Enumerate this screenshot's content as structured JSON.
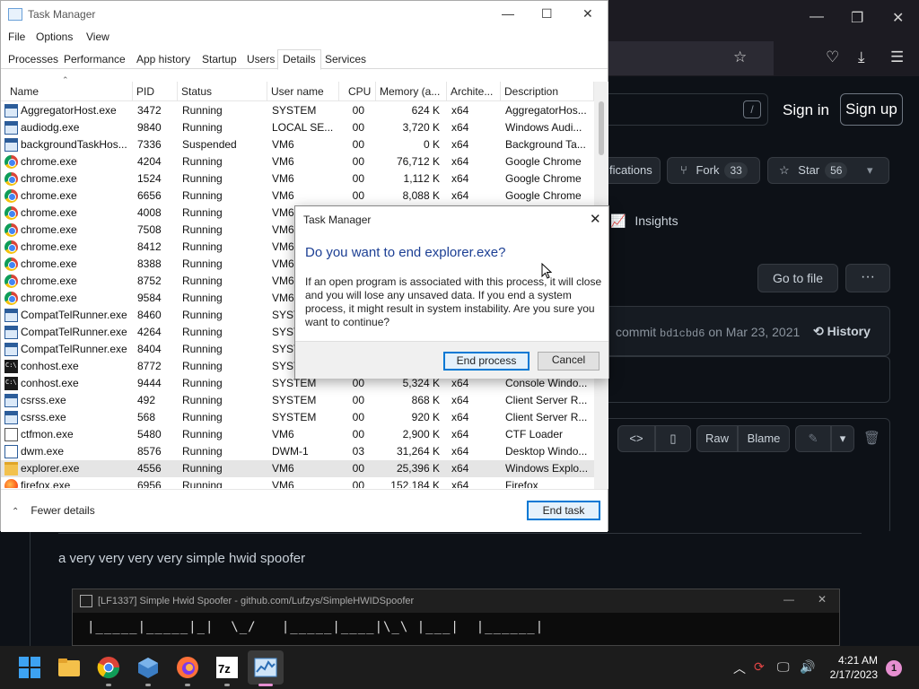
{
  "browser": {
    "controls": [
      "—",
      "❐",
      "✕"
    ],
    "toolbar_icons": [
      "star-icon",
      "pocket-icon",
      "download-icon",
      "menu-icon"
    ]
  },
  "github": {
    "slash": "/",
    "sign_in": "Sign in",
    "sign_up": "Sign up",
    "notifications_label": "fications",
    "fork_label": "Fork",
    "fork_count": "33",
    "star_label": "Star",
    "star_count": "56",
    "insights": "Insights",
    "go_to_file": "Go to file",
    "more": "···",
    "commit_text": "commit",
    "commit_sha": "bd1cbd6",
    "commit_date": "on Mar 23, 2021",
    "history": "History",
    "raw": "Raw",
    "blame": "Blame",
    "readme_text": "a very very very very simple hwid spoofer",
    "console_title": "[LF1337] Simple Hwid Spoofer - github.com/Lufzys/SimpleHWIDSpoofer",
    "console_art": "|_____|_____|_|  \\_/   |_____|____|\\_\\ |___|  |______|"
  },
  "task_manager": {
    "title": "Task Manager",
    "menu": [
      "File",
      "Options",
      "View"
    ],
    "tabs": [
      "Processes",
      "Performance",
      "App history",
      "Startup",
      "Users",
      "Details",
      "Services"
    ],
    "active_tab": "Details",
    "columns": [
      "Name",
      "PID",
      "Status",
      "User name",
      "CPU",
      "Memory (a...",
      "Archite...",
      "Description"
    ],
    "rows": [
      {
        "icon": "app",
        "name": "AggregatorHost.exe",
        "pid": "3472",
        "status": "Running",
        "user": "SYSTEM",
        "cpu": "00",
        "mem": "624 K",
        "arch": "x64",
        "desc": "AggregatorHos..."
      },
      {
        "icon": "app",
        "name": "audiodg.exe",
        "pid": "9840",
        "status": "Running",
        "user": "LOCAL SE...",
        "cpu": "00",
        "mem": "3,720 K",
        "arch": "x64",
        "desc": "Windows Audi..."
      },
      {
        "icon": "app",
        "name": "backgroundTaskHos...",
        "pid": "7336",
        "status": "Suspended",
        "user": "VM6",
        "cpu": "00",
        "mem": "0 K",
        "arch": "x64",
        "desc": "Background Ta..."
      },
      {
        "icon": "chrome",
        "name": "chrome.exe",
        "pid": "4204",
        "status": "Running",
        "user": "VM6",
        "cpu": "00",
        "mem": "76,712 K",
        "arch": "x64",
        "desc": "Google Chrome"
      },
      {
        "icon": "chrome",
        "name": "chrome.exe",
        "pid": "1524",
        "status": "Running",
        "user": "VM6",
        "cpu": "00",
        "mem": "1,112 K",
        "arch": "x64",
        "desc": "Google Chrome"
      },
      {
        "icon": "chrome",
        "name": "chrome.exe",
        "pid": "6656",
        "status": "Running",
        "user": "VM6",
        "cpu": "00",
        "mem": "8,088 K",
        "arch": "x64",
        "desc": "Google Chrome"
      },
      {
        "icon": "chrome",
        "name": "chrome.exe",
        "pid": "4008",
        "status": "Running",
        "user": "VM6",
        "cpu": "",
        "mem": "",
        "arch": "",
        "desc": ""
      },
      {
        "icon": "chrome",
        "name": "chrome.exe",
        "pid": "7508",
        "status": "Running",
        "user": "VM6",
        "cpu": "",
        "mem": "",
        "arch": "",
        "desc": ""
      },
      {
        "icon": "chrome",
        "name": "chrome.exe",
        "pid": "8412",
        "status": "Running",
        "user": "VM6",
        "cpu": "",
        "mem": "",
        "arch": "",
        "desc": ""
      },
      {
        "icon": "chrome",
        "name": "chrome.exe",
        "pid": "8388",
        "status": "Running",
        "user": "VM6",
        "cpu": "",
        "mem": "",
        "arch": "",
        "desc": ""
      },
      {
        "icon": "chrome",
        "name": "chrome.exe",
        "pid": "8752",
        "status": "Running",
        "user": "VM6",
        "cpu": "",
        "mem": "",
        "arch": "",
        "desc": ""
      },
      {
        "icon": "chrome",
        "name": "chrome.exe",
        "pid": "9584",
        "status": "Running",
        "user": "VM6",
        "cpu": "",
        "mem": "",
        "arch": "",
        "desc": ""
      },
      {
        "icon": "app",
        "name": "CompatTelRunner.exe",
        "pid": "8460",
        "status": "Running",
        "user": "SYST",
        "cpu": "",
        "mem": "",
        "arch": "",
        "desc": ""
      },
      {
        "icon": "app",
        "name": "CompatTelRunner.exe",
        "pid": "4264",
        "status": "Running",
        "user": "SYST",
        "cpu": "",
        "mem": "",
        "arch": "",
        "desc": ""
      },
      {
        "icon": "app",
        "name": "CompatTelRunner.exe",
        "pid": "8404",
        "status": "Running",
        "user": "SYST",
        "cpu": "",
        "mem": "",
        "arch": "",
        "desc": ""
      },
      {
        "icon": "console",
        "name": "conhost.exe",
        "pid": "8772",
        "status": "Running",
        "user": "SYST",
        "cpu": "",
        "mem": "",
        "arch": "",
        "desc": ""
      },
      {
        "icon": "console",
        "name": "conhost.exe",
        "pid": "9444",
        "status": "Running",
        "user": "SYSTEM",
        "cpu": "00",
        "mem": "5,324 K",
        "arch": "x64",
        "desc": "Console Windo..."
      },
      {
        "icon": "app",
        "name": "csrss.exe",
        "pid": "492",
        "status": "Running",
        "user": "SYSTEM",
        "cpu": "00",
        "mem": "868 K",
        "arch": "x64",
        "desc": "Client Server R..."
      },
      {
        "icon": "app",
        "name": "csrss.exe",
        "pid": "568",
        "status": "Running",
        "user": "SYSTEM",
        "cpu": "00",
        "mem": "920 K",
        "arch": "x64",
        "desc": "Client Server R..."
      },
      {
        "icon": "pen",
        "name": "ctfmon.exe",
        "pid": "5480",
        "status": "Running",
        "user": "VM6",
        "cpu": "00",
        "mem": "2,900 K",
        "arch": "x64",
        "desc": "CTF Loader"
      },
      {
        "icon": "dwm",
        "name": "dwm.exe",
        "pid": "8576",
        "status": "Running",
        "user": "DWM-1",
        "cpu": "03",
        "mem": "31,264 K",
        "arch": "x64",
        "desc": "Desktop Windo..."
      },
      {
        "icon": "folder",
        "name": "explorer.exe",
        "pid": "4556",
        "status": "Running",
        "user": "VM6",
        "cpu": "00",
        "mem": "25,396 K",
        "arch": "x64",
        "desc": "Windows Explo...",
        "selected": true
      },
      {
        "icon": "firefox",
        "name": "firefox.exe",
        "pid": "6956",
        "status": "Running",
        "user": "VM6",
        "cpu": "00",
        "mem": "152,184 K",
        "arch": "x64",
        "desc": "Firefox"
      }
    ],
    "fewer_details": "Fewer details",
    "end_task": "End task"
  },
  "dialog": {
    "title": "Task Manager",
    "question": "Do you want to end explorer.exe?",
    "message": "If an open program is associated with this process, it will close and you will lose any unsaved data. If you end a system process, it might result in system instability. Are you sure you want to continue?",
    "end_process": "End process",
    "cancel": "Cancel"
  },
  "taskbar": {
    "apps": [
      "start",
      "file-explorer",
      "chrome",
      "virtualbox",
      "firefox",
      "7zip",
      "task-manager"
    ],
    "time": "4:21 AM",
    "date": "2/17/2023",
    "notification_count": "1"
  }
}
